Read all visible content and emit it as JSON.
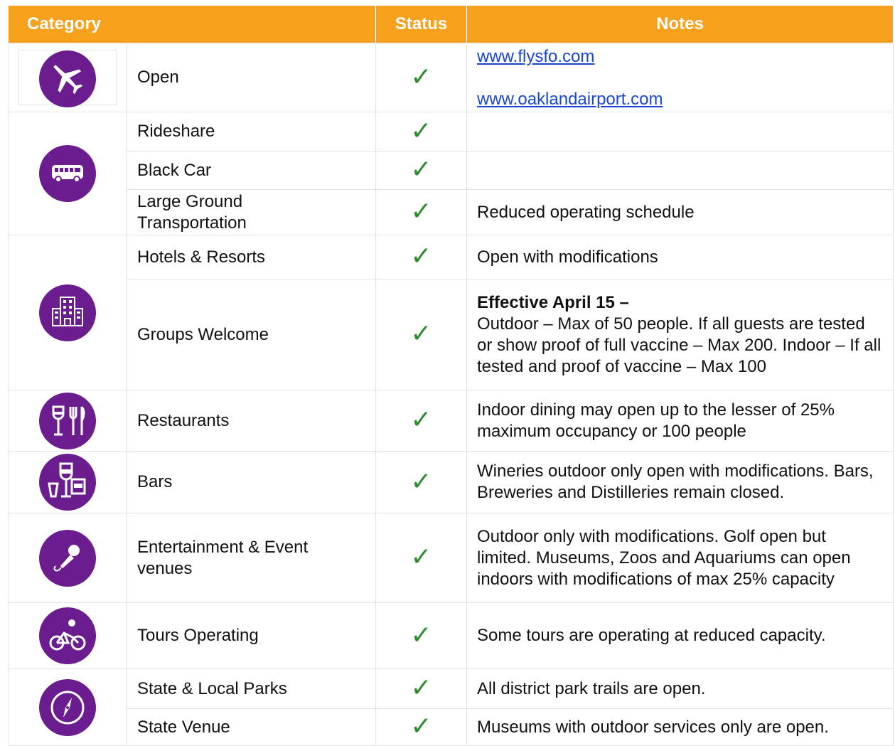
{
  "header": {
    "category": "Category",
    "status": "Status",
    "notes": "Notes"
  },
  "status_glyph": "✓",
  "colors": {
    "header_bg": "#f7a11d",
    "icon_bg": "#6b1d8f",
    "check": "#2e8b2e",
    "link": "#1a46d6"
  },
  "rows": [
    {
      "icon": "airplane-icon",
      "label": "Open",
      "links": [
        "www.flysfo.com",
        "www.oaklandairport.com"
      ]
    },
    {
      "icon": "bus-icon",
      "label": "Rideshare",
      "note": ""
    },
    {
      "label": "Black Car",
      "note": ""
    },
    {
      "label_lines": [
        "Large Ground",
        "Transportation"
      ],
      "note": "Reduced operating schedule"
    },
    {
      "icon": "building-icon",
      "label": "Hotels & Resorts",
      "note": "Open with modifications"
    },
    {
      "label": "Groups Welcome",
      "note_bold": "Effective April 15 –",
      "note": "Outdoor – Max of 50 people.  If all guests are tested or show proof of full vaccine – Max 200.  Indoor – If all tested and proof of vaccine – Max 100"
    },
    {
      "icon": "dining-icon",
      "label": "Restaurants",
      "note": "Indoor dining may open up to the lesser of 25% maximum occupancy or 100 people"
    },
    {
      "icon": "drinks-icon",
      "label": "Bars",
      "note": "Wineries outdoor only open with modifications. Bars, Breweries and Distilleries remain closed."
    },
    {
      "icon": "microphone-icon",
      "label": "Entertainment & Event venues",
      "note": "Outdoor only with modifications.  Golf open but limited.  Museums, Zoos and Aquariums can open indoors with modifications of max 25% capacity"
    },
    {
      "icon": "bicycle-icon",
      "label": "Tours Operating",
      "note": "Some tours are operating at reduced capacity."
    },
    {
      "icon": "compass-icon",
      "label": "State & Local Parks",
      "note": "All district park trails are open."
    },
    {
      "label": "State Venue",
      "note": "Museums with outdoor services only are open."
    }
  ]
}
